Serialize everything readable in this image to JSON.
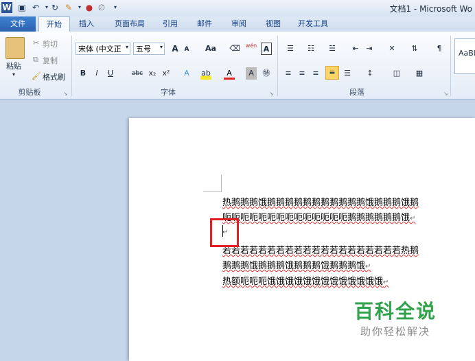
{
  "title_bar": {
    "title": "文档1 - Microsoft Wo"
  },
  "tabs": [
    {
      "label": "文件"
    },
    {
      "label": "开始"
    },
    {
      "label": "插入"
    },
    {
      "label": "页面布局"
    },
    {
      "label": "引用"
    },
    {
      "label": "邮件"
    },
    {
      "label": "审阅"
    },
    {
      "label": "视图"
    },
    {
      "label": "开发工具"
    }
  ],
  "clipboard": {
    "paste": "粘贴",
    "cut": "剪切",
    "copy": "复制",
    "format_painter": "格式刷",
    "group": "剪贴板"
  },
  "font": {
    "name": "宋体 (中文正",
    "size": "五号",
    "grow": "A",
    "shrink": "A",
    "case": "Aa",
    "pinyin": "wén",
    "group": "字体"
  },
  "paragraph": {
    "group": "段落"
  },
  "styles": {
    "sample": "AaBl"
  },
  "document": {
    "lines": [
      "热鹅鹅鹅饿鹅鹅鹅鹅鹅鹅鹅鹅鹅鹅鹅饿鹅鹅鹅饿鹅",
      "呃呃呃呃呃呃呃呃呃呃呃呃呃呃鹅鹅鹅鹅鹅鹅饿",
      "",
      "若若若若若若若若若若若若若若若若若若若若热鹅",
      "鹅鹅鹅饿鹅鹅鹅饿鹅鹅鹅饿鹅鹅鹅饿",
      "热额呃呃呃饿饿饿饿饿饿饿饿饿饿饿饿饿"
    ]
  },
  "watermark": {
    "title": "百科全说",
    "subtitle": "助你轻松解决"
  },
  "colors": {
    "highlight": "#e02020",
    "watermark": "#2fa24b",
    "file_tab": "#2a62b1"
  }
}
